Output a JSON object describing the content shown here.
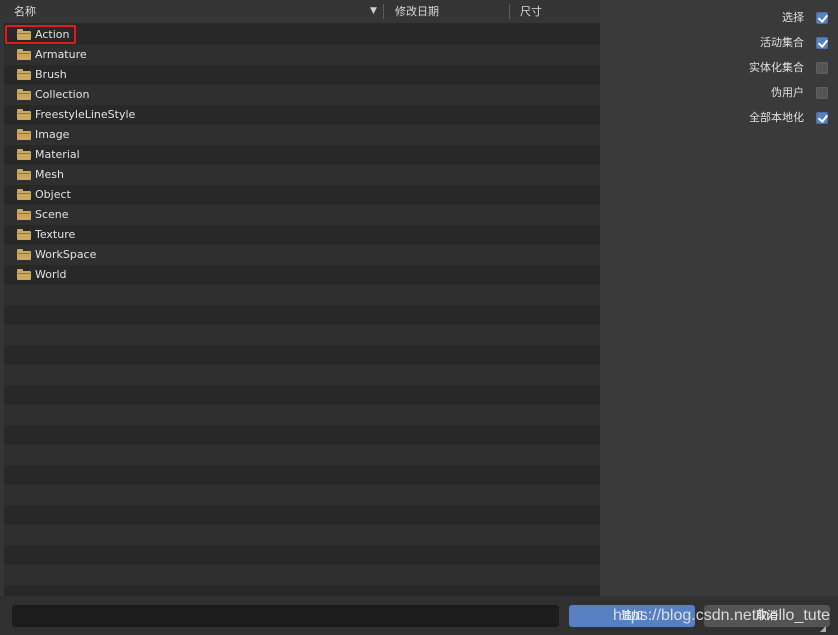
{
  "columns": {
    "name": "名称",
    "modified": "修改日期",
    "size": "尺寸"
  },
  "files": [
    {
      "name": "Action",
      "icon": "folder-icon",
      "highlighted": true
    },
    {
      "name": "Armature",
      "icon": "folder-icon"
    },
    {
      "name": "Brush",
      "icon": "folder-icon"
    },
    {
      "name": "Collection",
      "icon": "folder-icon"
    },
    {
      "name": "FreestyleLineStyle",
      "icon": "folder-icon"
    },
    {
      "name": "Image",
      "icon": "folder-icon"
    },
    {
      "name": "Material",
      "icon": "folder-icon"
    },
    {
      "name": "Mesh",
      "icon": "folder-icon"
    },
    {
      "name": "Object",
      "icon": "folder-icon"
    },
    {
      "name": "Scene",
      "icon": "folder-icon"
    },
    {
      "name": "Texture",
      "icon": "folder-icon"
    },
    {
      "name": "WorkSpace",
      "icon": "folder-icon"
    },
    {
      "name": "World",
      "icon": "folder-icon"
    }
  ],
  "options": [
    {
      "label": "选择",
      "checked": true
    },
    {
      "label": "活动集合",
      "checked": true
    },
    {
      "label": "实体化集合",
      "checked": false
    },
    {
      "label": "伪用户",
      "checked": false
    },
    {
      "label": "全部本地化",
      "checked": true
    }
  ],
  "bottom": {
    "filename_value": "",
    "primary_label": "追加",
    "cancel_label": "取消",
    "watermark": "https://blog.csdn.net/hello_tute"
  },
  "colors": {
    "accent": "#5680c2",
    "highlight_border": "#e01b1b",
    "folder": "#c9a75d"
  }
}
